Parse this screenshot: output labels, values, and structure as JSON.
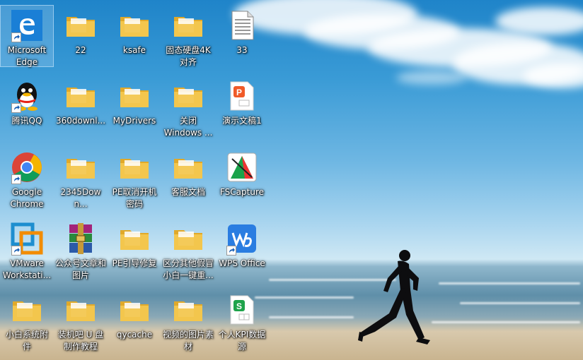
{
  "desktop": {
    "icons": [
      {
        "label": "Microsoft\nEdge",
        "icon": "edge-icon",
        "shortcut": true
      },
      {
        "label": "22",
        "icon": "folder-icon",
        "shortcut": false
      },
      {
        "label": "ksafe",
        "icon": "folder-icon",
        "shortcut": false
      },
      {
        "label": "固态硬盘4K\n对齐",
        "icon": "folder-icon",
        "shortcut": false
      },
      {
        "label": "33",
        "icon": "text-file-icon",
        "shortcut": false
      },
      {
        "label": "腾讯QQ",
        "icon": "qq-icon",
        "shortcut": true
      },
      {
        "label": "360downl...",
        "icon": "folder-icon",
        "shortcut": false
      },
      {
        "label": "MyDrivers",
        "icon": "folder-icon",
        "shortcut": false
      },
      {
        "label": "关闭\nWindows ...",
        "icon": "folder-icon",
        "shortcut": false
      },
      {
        "label": "演示文稿1",
        "icon": "wps-presentation-icon",
        "shortcut": false
      },
      {
        "label": "Google\nChrome",
        "icon": "chrome-icon",
        "shortcut": true
      },
      {
        "label": "2345Down...",
        "icon": "folder-icon",
        "shortcut": false
      },
      {
        "label": "PE取消开机\n密码",
        "icon": "folder-icon",
        "shortcut": false
      },
      {
        "label": "客服文档",
        "icon": "folder-icon",
        "shortcut": false
      },
      {
        "label": "FSCapture",
        "icon": "fscapture-icon",
        "shortcut": false
      },
      {
        "label": "VMware\nWorkstati...",
        "icon": "vmware-icon",
        "shortcut": true
      },
      {
        "label": "公众号文章和\n图片",
        "icon": "winrar-icon",
        "shortcut": false
      },
      {
        "label": "PE引导修复",
        "icon": "folder-icon",
        "shortcut": false
      },
      {
        "label": "区分其他假冒\n小白一键重...",
        "icon": "folder-icon",
        "shortcut": false
      },
      {
        "label": "WPS Office",
        "icon": "wps-office-icon",
        "shortcut": true
      },
      {
        "label": "小白系统附\n件",
        "icon": "folder-icon",
        "shortcut": false
      },
      {
        "label": "装机吧 U 盘\n制作教程",
        "icon": "folder-icon",
        "shortcut": false
      },
      {
        "label": "qycache",
        "icon": "folder-icon",
        "shortcut": false
      },
      {
        "label": "视频的图片素\n材",
        "icon": "folder-icon",
        "shortcut": false
      },
      {
        "label": "个人KPI数据\n源",
        "icon": "wps-spreadsheet-icon",
        "shortcut": false
      }
    ]
  },
  "colors": {
    "folder": "#f3c64d",
    "folder_dark": "#e0a92a",
    "edge": "#1a7fd6",
    "chrome_red": "#db4437",
    "chrome_yellow": "#f4b400",
    "chrome_green": "#0f9d58",
    "chrome_blue": "#4285f4",
    "wps_blue": "#2a7de1",
    "wps_orange": "#f05a28",
    "wps_green": "#1fa34b",
    "vmware_blue": "#1d8ecf",
    "vmware_orange": "#f28c00"
  }
}
